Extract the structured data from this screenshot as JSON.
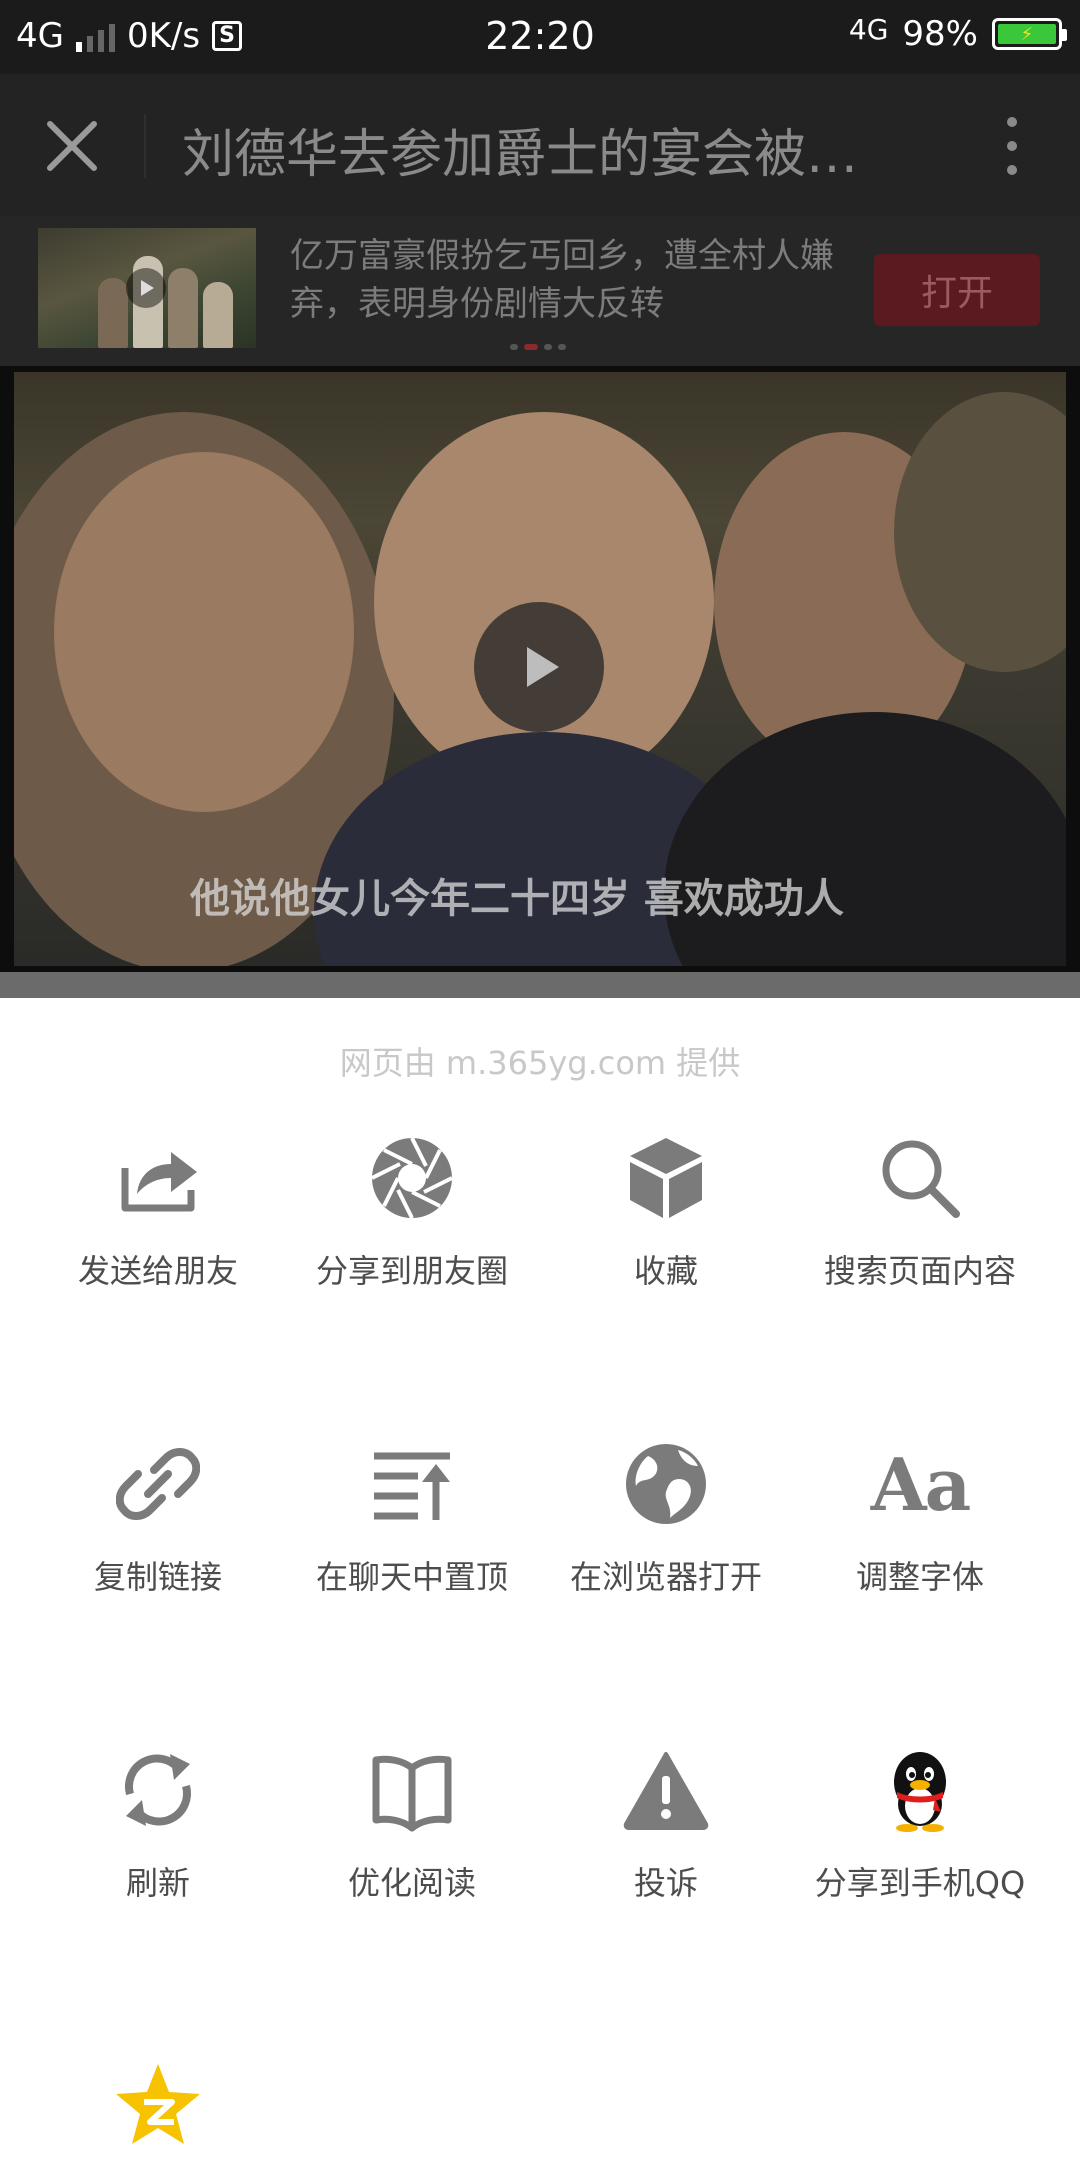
{
  "status_bar": {
    "network_left": "4G",
    "speed": "0K/s",
    "s_badge": "S",
    "time": "22:20",
    "network_right": "4G",
    "battery": "98%",
    "charging_glyph": "⚡"
  },
  "title_bar": {
    "title": "刘德华去参加爵士的宴会被…"
  },
  "ad": {
    "text": "亿万富豪假扮乞丐回乡，遭全村人嫌弃，表明身份剧情大反转",
    "button": "打开"
  },
  "video": {
    "subtitle": "他说他女儿今年二十四岁 喜欢成功人"
  },
  "sheet": {
    "provider": "网页由 m.365yg.com 提供",
    "items": [
      {
        "label": "发送给朋友",
        "icon": "share-to-friend-icon"
      },
      {
        "label": "分享到朋友圈",
        "icon": "moments-icon"
      },
      {
        "label": "收藏",
        "icon": "favorite-cube-icon"
      },
      {
        "label": "搜索页面内容",
        "icon": "search-icon"
      },
      {
        "label": "复制链接",
        "icon": "link-icon"
      },
      {
        "label": "在聊天中置顶",
        "icon": "pin-to-top-icon"
      },
      {
        "label": "在浏览器打开",
        "icon": "globe-icon"
      },
      {
        "label": "调整字体",
        "icon": "font-icon",
        "glyph": "Aa"
      },
      {
        "label": "刷新",
        "icon": "refresh-icon"
      },
      {
        "label": "优化阅读",
        "icon": "book-icon"
      },
      {
        "label": "投诉",
        "icon": "warning-icon"
      },
      {
        "label": "分享到手机QQ",
        "icon": "qq-penguin-icon"
      },
      {
        "label": "",
        "icon": "qzone-star-icon"
      }
    ]
  },
  "colors": {
    "qzone_star": "#f7c200",
    "icon_gray": "#7b7b7b",
    "ad_button_bg": "#5a1a1f"
  }
}
